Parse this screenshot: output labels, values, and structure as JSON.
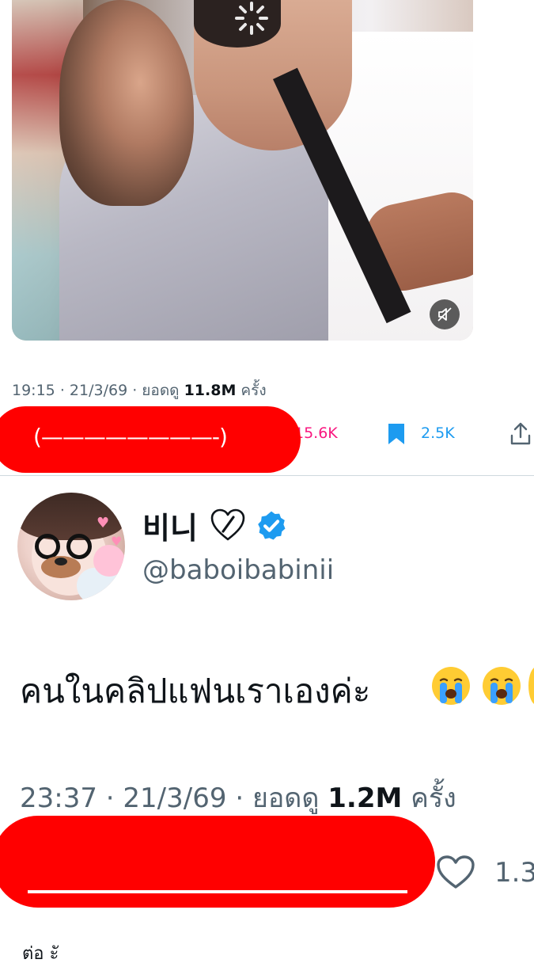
{
  "tweet1": {
    "time": "19:15",
    "date": "21/3/69",
    "views_label": "ยอดดู",
    "views": "11.8M",
    "views_suffix": "ครั้ง",
    "likes": "15.6K",
    "bookmarks": "2.5K",
    "redaction_scribble": "(————————-)"
  },
  "tweet2": {
    "display_name": "비니",
    "handle": "@baboibabinii",
    "text": "คนในคลิปแฟนเราเองค่ะ",
    "time": "23:37",
    "date": "21/3/69",
    "views_label": "ยอดดู",
    "views": "1.2M",
    "views_suffix": "ครั้ง",
    "likes": "1.3",
    "bottom_peek": "ต่อ ะั"
  },
  "colors": {
    "redaction": "#ff0000",
    "verified": "#1d9bf0",
    "like": "#f91880",
    "bookmark": "#1d9bf0",
    "muted_text": "#536471"
  },
  "icons": [
    "spinner-icon",
    "mute-icon",
    "bookmark-icon",
    "share-icon",
    "verified-icon",
    "broken-heart-emoji",
    "crying-emoji",
    "heart-icon"
  ]
}
